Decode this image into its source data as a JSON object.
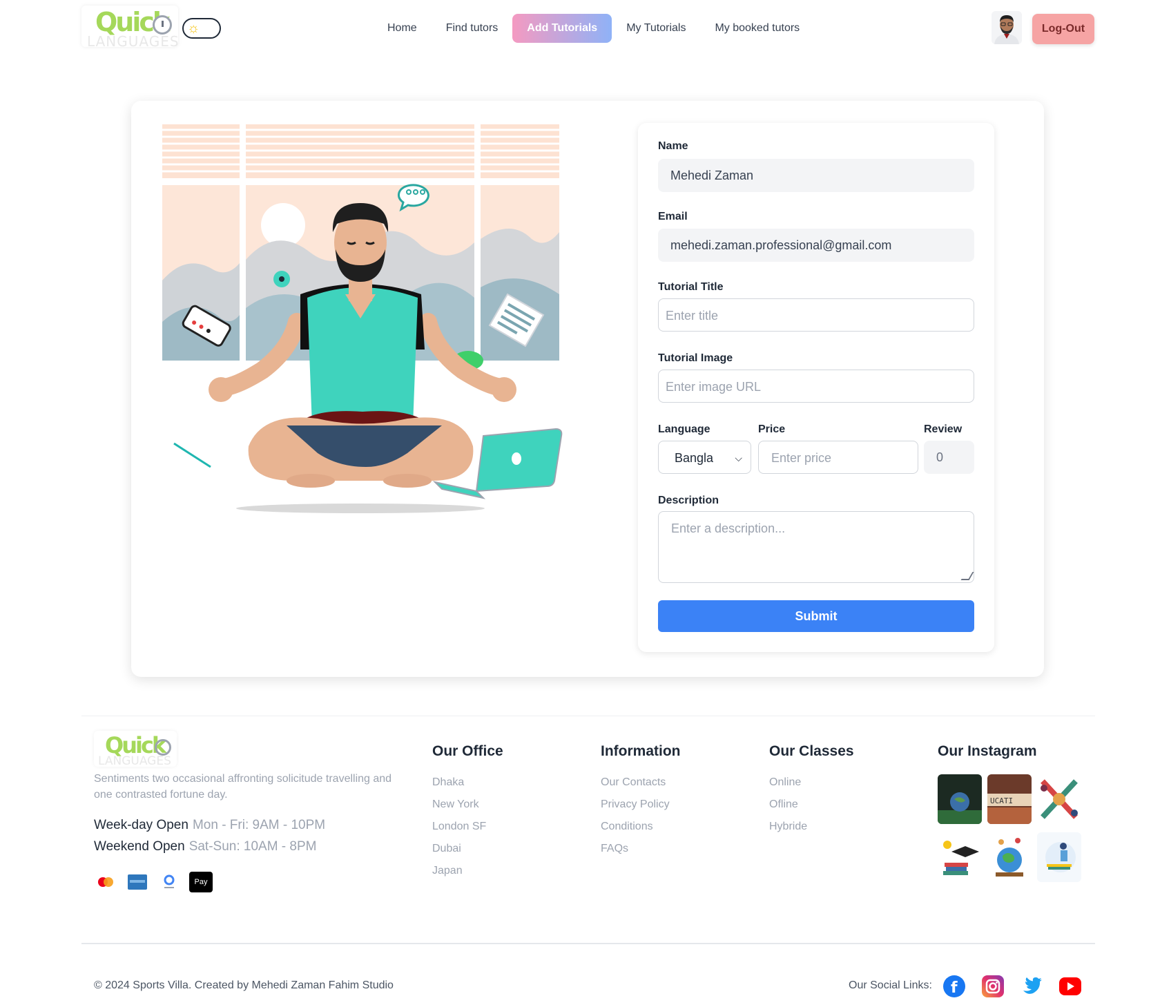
{
  "brand": {
    "logo_text": "Quick",
    "logo_sub": "LANGUAGES"
  },
  "nav": {
    "items": [
      {
        "label": "Home",
        "active": false
      },
      {
        "label": "Find tutors",
        "active": false
      },
      {
        "label": "Add Tutorials",
        "active": true
      },
      {
        "label": "My Tutorials",
        "active": false
      },
      {
        "label": "My booked tutors",
        "active": false
      }
    ],
    "logout_label": "Log-Out",
    "theme_icon": "sun-icon"
  },
  "form": {
    "name_label": "Name",
    "name_value": "Mehedi Zaman",
    "email_label": "Email",
    "email_value": "mehedi.zaman.professional@gmail.com",
    "title_label": "Tutorial Title",
    "title_placeholder": "Enter title",
    "image_label": "Tutorial Image",
    "image_placeholder": "Enter image URL",
    "language_label": "Language",
    "language_value": "Bangla",
    "price_label": "Price",
    "price_placeholder": "Enter price",
    "review_label": "Review",
    "review_value": "0",
    "description_label": "Description",
    "description_placeholder": "Enter a description...",
    "submit_label": "Submit"
  },
  "footer": {
    "description": "Sentiments two occasional affronting solicitude travelling and one contrasted fortune day.",
    "weekday_label": "Week-day Open",
    "weekday_value": "Mon - Fri: 9AM - 10PM",
    "weekend_label": "Weekend Open",
    "weekend_value": "Sat-Sun: 10AM - 8PM",
    "columns": [
      {
        "title": "Our Office",
        "items": [
          "Dhaka",
          "New York",
          "London SF",
          "Dubai",
          "Japan"
        ]
      },
      {
        "title": "Information",
        "items": [
          "Our Contacts",
          "Privacy Policy",
          "Conditions",
          "FAQs"
        ]
      },
      {
        "title": "Our Classes",
        "items": [
          "Online",
          "Ofline",
          "Hybride"
        ]
      }
    ],
    "instagram_title": "Our Instagram",
    "copyright": "© 2024 Sports Villa. Created by Mehedi Zaman Fahim Studio",
    "social_label": "Our Social Links:",
    "social_icons": [
      "facebook-icon",
      "instagram-icon",
      "twitter-icon",
      "youtube-icon"
    ],
    "pay_icons": [
      "mastercard-icon",
      "amex-icon",
      "google-pay-icon",
      "apple-pay-icon"
    ],
    "pay_apple_text": "Pay"
  },
  "colors": {
    "primary": "#3b82f6",
    "logout_bg": "#f6a4a4",
    "nav_active_from": "#f49ac1",
    "nav_active_to": "#8fb2f7",
    "brand_green": "#a5d85a",
    "illus_teal": "#3fd3bd"
  }
}
